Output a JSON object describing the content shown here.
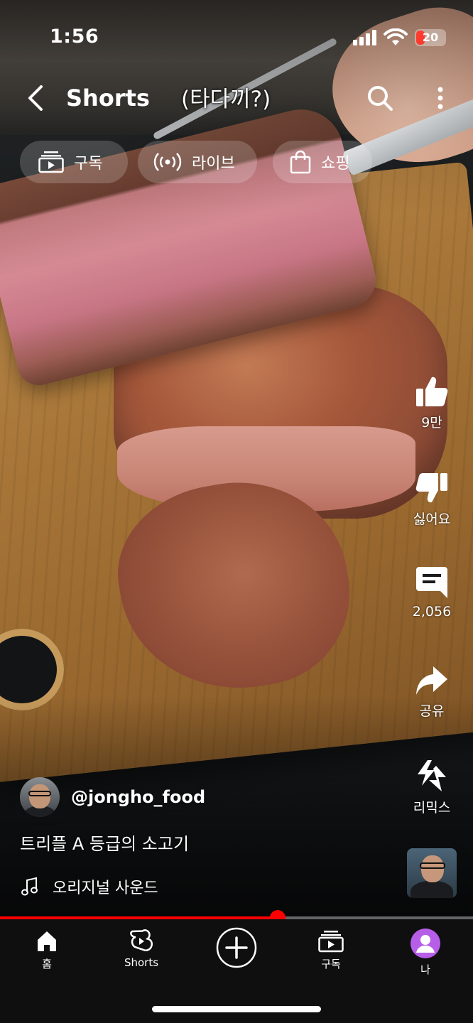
{
  "status_bar": {
    "time": "1:56",
    "battery": "20"
  },
  "header": {
    "title": "Shorts",
    "caption": "(타다끼?)"
  },
  "chips": [
    {
      "label": "구독",
      "icon": "subscriptions-icon"
    },
    {
      "label": "라이브",
      "icon": "live-icon"
    },
    {
      "label": "쇼핑",
      "icon": "shopping-bag-icon"
    }
  ],
  "actions": {
    "like_count": "9만",
    "dislike_label": "싫어요",
    "comment_count": "2,056",
    "share_label": "공유",
    "remix_label": "리믹스"
  },
  "video": {
    "channel_handle": "@jongho_food",
    "title": "트리플  A 등급의 소고기",
    "sound": "오리지널 사운드",
    "progress_fraction": 0.587
  },
  "nav": [
    {
      "label": "홈",
      "icon": "home-icon"
    },
    {
      "label": "Shorts",
      "icon": "shorts-icon"
    },
    {
      "label": "",
      "icon": "create-plus-icon"
    },
    {
      "label": "구독",
      "icon": "subscriptions-icon"
    },
    {
      "label": "나",
      "icon": "profile-avatar-icon"
    }
  ],
  "colors": {
    "accent": "#ff0000",
    "profile": "#b65ee8"
  }
}
